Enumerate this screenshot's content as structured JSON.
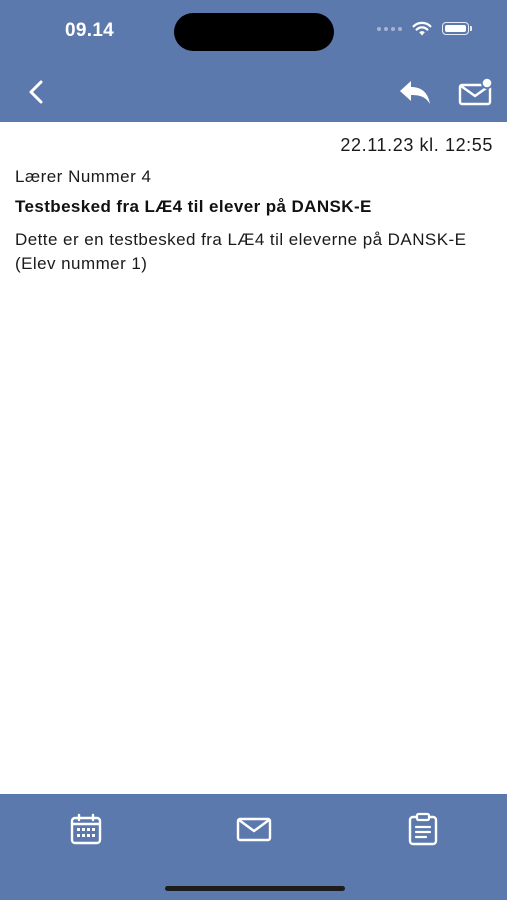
{
  "status_bar": {
    "time": "09.14"
  },
  "nav_bar": {
    "back_icon": "chevron-left-icon",
    "reply_icon": "reply-icon",
    "new_message_icon": "mail-badge-icon"
  },
  "message": {
    "date": "22.11.23 kl. 12:55",
    "sender": "Lærer Nummer 4",
    "subject": "Testbesked fra LÆ4 til elever på DANSK-E",
    "body": "Dette er en testbesked fra LÆ4 til eleverne på DANSK-E (Elev nummer 1)"
  },
  "tab_bar": {
    "tabs": [
      {
        "icon": "calendar-icon"
      },
      {
        "icon": "mail-icon"
      },
      {
        "icon": "clipboard-icon"
      }
    ]
  },
  "colors": {
    "bar_background": "#5c79ad",
    "icon_color": "#ffffff",
    "text_color": "#1a1a1a"
  }
}
